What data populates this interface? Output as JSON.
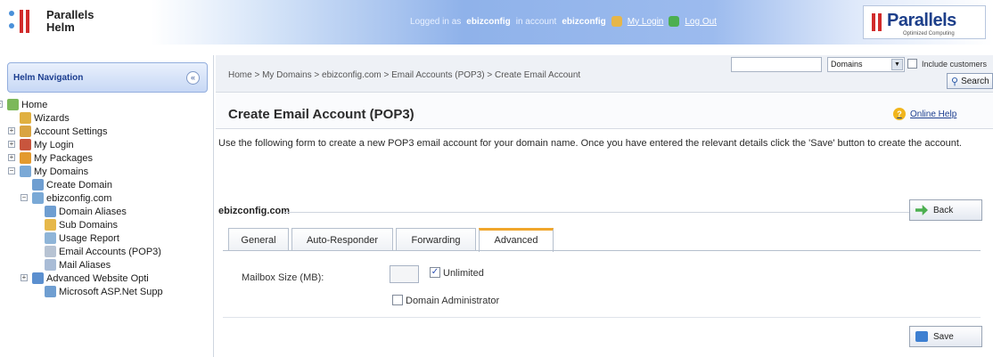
{
  "brand": {
    "line1": "Parallels",
    "line2": "Helm"
  },
  "userbar": {
    "logged_in_prefix": "Logged in as",
    "user": "ebizconfig",
    "in_account": "in account",
    "account": "ebizconfig",
    "my_login": "My Login",
    "log_out": "Log Out"
  },
  "corner_logo": {
    "word": "Parallels",
    "tagline": "Optimized Computing"
  },
  "nav": {
    "title": "Helm Navigation",
    "collapse_glyph": "«",
    "items": [
      {
        "label": "Home",
        "indent": 0,
        "toggle": "−",
        "icon_color": "#7cb85a"
      },
      {
        "label": "Wizards",
        "indent": 1,
        "toggle": "",
        "icon_color": "#e0b040"
      },
      {
        "label": "Account Settings",
        "indent": 1,
        "toggle": "+",
        "icon_color": "#d9a441"
      },
      {
        "label": "My Login",
        "indent": 1,
        "toggle": "+",
        "icon_color": "#c8553d"
      },
      {
        "label": "My Packages",
        "indent": 1,
        "toggle": "+",
        "icon_color": "#e39a2e"
      },
      {
        "label": "My Domains",
        "indent": 1,
        "toggle": "−",
        "icon_color": "#7aa9d6"
      },
      {
        "label": "Create Domain",
        "indent": 2,
        "toggle": "",
        "icon_color": "#6f9ed1"
      },
      {
        "label": "ebizconfig.com",
        "indent": 2,
        "toggle": "−",
        "icon_color": "#7aa9d6"
      },
      {
        "label": "Domain Aliases",
        "indent": 3,
        "toggle": "",
        "icon_color": "#6f9ed1"
      },
      {
        "label": "Sub Domains",
        "indent": 3,
        "toggle": "",
        "icon_color": "#e6b84a"
      },
      {
        "label": "Usage Report",
        "indent": 3,
        "toggle": "",
        "icon_color": "#8fb5d8"
      },
      {
        "label": "Email Accounts (POP3)",
        "indent": 3,
        "toggle": "",
        "icon_color": "#b7c3d3"
      },
      {
        "label": "Mail Aliases",
        "indent": 3,
        "toggle": "",
        "icon_color": "#a9bcd6"
      },
      {
        "label": "Advanced Website Opti",
        "indent": 2,
        "toggle": "+",
        "icon_color": "#5b8fcf"
      },
      {
        "label": "Microsoft ASP.Net Supp",
        "indent": 3,
        "toggle": "",
        "icon_color": "#6f9ed1"
      }
    ]
  },
  "breadcrumb": "Home > My Domains > ebizconfig.com > Email Accounts (POP3) > Create Email Account",
  "search": {
    "value": "",
    "select_value": "Domains",
    "include_customers": "Include customers",
    "button": "Search"
  },
  "page": {
    "title": "Create Email Account (POP3)",
    "help": "Online Help",
    "intro": "Use the following form to create a new POP3 email account for your domain name. Once you have entered the relevant details click the 'Save' button to create the account.",
    "domain": "ebizconfig.com",
    "back": "Back",
    "save": "Save"
  },
  "tabs": [
    {
      "label": "General",
      "active": false
    },
    {
      "label": "Auto-Responder",
      "active": false
    },
    {
      "label": "Forwarding",
      "active": false
    },
    {
      "label": "Advanced",
      "active": true
    }
  ],
  "form": {
    "mailbox_label": "Mailbox Size (MB):",
    "mailbox_value": "",
    "unlimited_label": "Unlimited",
    "unlimited_checked": true,
    "domain_admin_label": "Domain Administrator",
    "domain_admin_checked": false
  },
  "colors": {
    "accent": "#1b3d8f",
    "brand_red": "#d12b2b",
    "active_tab": "#f0a62c"
  }
}
